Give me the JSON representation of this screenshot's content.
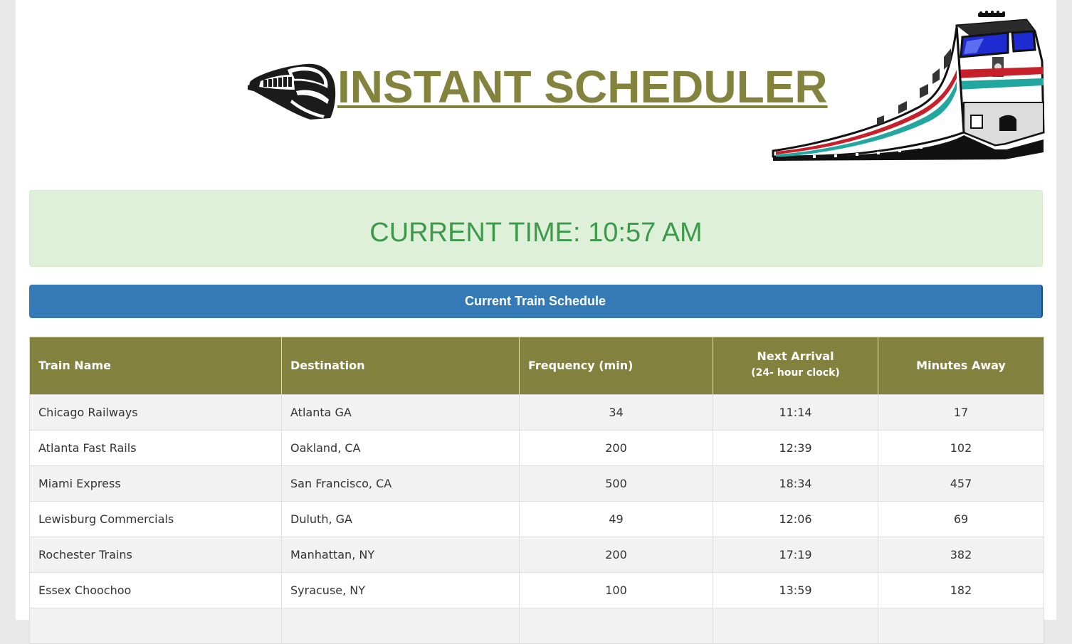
{
  "header": {
    "title": "INSTANT SCHEDULER",
    "left_logo_icon": "train-front-icon",
    "right_logo_icon": "locomotive-icon"
  },
  "time_panel": {
    "text": "CURRENT TIME: 10:57 AM"
  },
  "schedule": {
    "title": "Current Train Schedule",
    "columns": {
      "train_name": "Train Name",
      "destination": "Destination",
      "frequency": "Frequency (min)",
      "next_arrival": "Next Arrival",
      "next_arrival_sub": "(24- hour clock)",
      "minutes_away": "Minutes Away"
    },
    "rows": [
      {
        "train_name": "Chicago Railways",
        "destination": "Atlanta GA",
        "frequency": "34",
        "next_arrival": "11:14",
        "minutes_away": "17"
      },
      {
        "train_name": "Atlanta Fast Rails",
        "destination": "Oakland, CA",
        "frequency": "200",
        "next_arrival": "12:39",
        "minutes_away": "102"
      },
      {
        "train_name": "Miami Express",
        "destination": "San Francisco, CA",
        "frequency": "500",
        "next_arrival": "18:34",
        "minutes_away": "457"
      },
      {
        "train_name": "Lewisburg Commercials",
        "destination": "Duluth, GA",
        "frequency": "49",
        "next_arrival": "12:06",
        "minutes_away": "69"
      },
      {
        "train_name": "Rochester Trains",
        "destination": "Manhattan, NY",
        "frequency": "200",
        "next_arrival": "17:19",
        "minutes_away": "382"
      },
      {
        "train_name": "Essex Choochoo",
        "destination": "Syracuse, NY",
        "frequency": "100",
        "next_arrival": "13:59",
        "minutes_away": "182"
      },
      {
        "train_name": "",
        "destination": "",
        "frequency": "",
        "next_arrival": "",
        "minutes_away": ""
      }
    ]
  },
  "colors": {
    "title": "#83833e",
    "time_panel_bg": "#dff0d8",
    "time_text": "#3c9a4b",
    "schedule_bar": "#337ab7",
    "table_header": "#83813e"
  }
}
